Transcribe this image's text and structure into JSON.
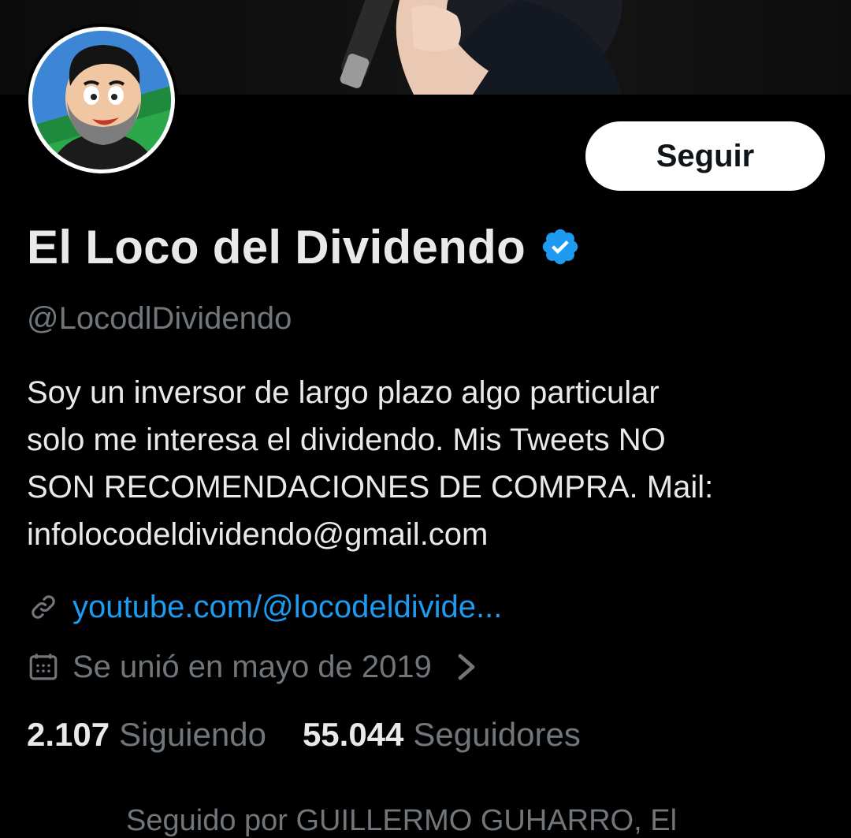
{
  "profile": {
    "display_name": "El Loco del Dividendo",
    "handle": "@LocodlDividendo",
    "follow_label": "Seguir",
    "bio_lines": [
      "Soy un inversor de largo plazo algo particular",
      "solo me interesa el dividendo. Mis Tweets NO",
      "SON RECOMENDACIONES DE COMPRA. Mail:",
      "infolocodeldividendo@gmail.com"
    ],
    "link": "youtube.com/@locodeldivide...",
    "joined": "Se unió en mayo de 2019",
    "following_count": "2.107",
    "following_label": "Siguiendo",
    "followers_count": "55.044",
    "followers_label": "Seguidores",
    "followed_by_partial": "Seguido por GUILLERMO GUHARRO, El"
  },
  "icons": {
    "verified": "verified-badge-icon",
    "link": "link-icon",
    "calendar": "calendar-icon",
    "chevron": "chevron-right-icon"
  },
  "colors": {
    "background": "#000000",
    "primary_text": "#e7e9ea",
    "secondary_text": "#71767b",
    "link": "#1d9bf0",
    "verified": "#1d9bf0",
    "button_bg": "#ffffff",
    "button_text": "#0f1419"
  }
}
